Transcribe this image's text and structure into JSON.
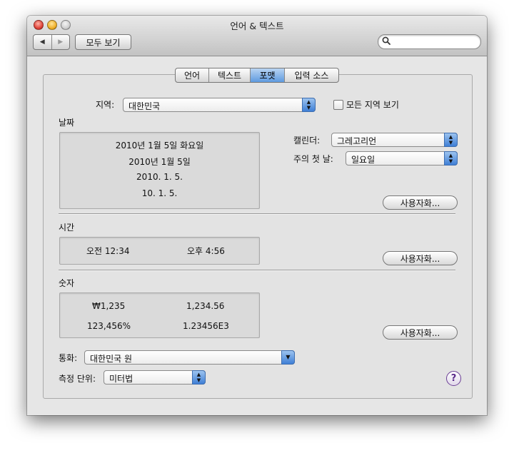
{
  "window": {
    "title": "언어 & 텍스트"
  },
  "toolbar": {
    "back_icon": "◀",
    "forward_icon": "▶",
    "show_all": "모두 보기",
    "search_icon": "magnifier-icon",
    "search_glyph": "🔍",
    "search_value": ""
  },
  "tabs": [
    {
      "label": "언어"
    },
    {
      "label": "텍스트"
    },
    {
      "label": "포맷",
      "selected": true
    },
    {
      "label": "입력 소스"
    }
  ],
  "region": {
    "label": "지역:",
    "value": "대한민국",
    "show_all_label": "모든 지역 보기",
    "show_all_checked": false
  },
  "dates": {
    "section": "날짜",
    "samples": [
      "2010년 1월 5일 화요일",
      "2010년 1월 5일",
      "2010. 1. 5.",
      "10. 1. 5."
    ],
    "calendar_label": "캘린더:",
    "calendar_value": "그레고리언",
    "first_day_label": "주의 첫 날:",
    "first_day_value": "일요일",
    "customize": "사용자화..."
  },
  "times": {
    "section": "시간",
    "samples": [
      "오전 12:34",
      "오후 4:56"
    ],
    "customize": "사용자화..."
  },
  "numbers": {
    "section": "숫자",
    "samples": [
      "₩1,235",
      "1,234.56",
      "123,456%",
      "1.23456E3"
    ],
    "customize": "사용자화..."
  },
  "currency": {
    "label": "통화:",
    "value": "대한민국 원"
  },
  "units": {
    "label": "측정 단위:",
    "value": "미터법"
  },
  "help": {
    "label": "?"
  },
  "colors": {
    "accent": "#5f9ae0",
    "help": "#5b2a8a"
  }
}
